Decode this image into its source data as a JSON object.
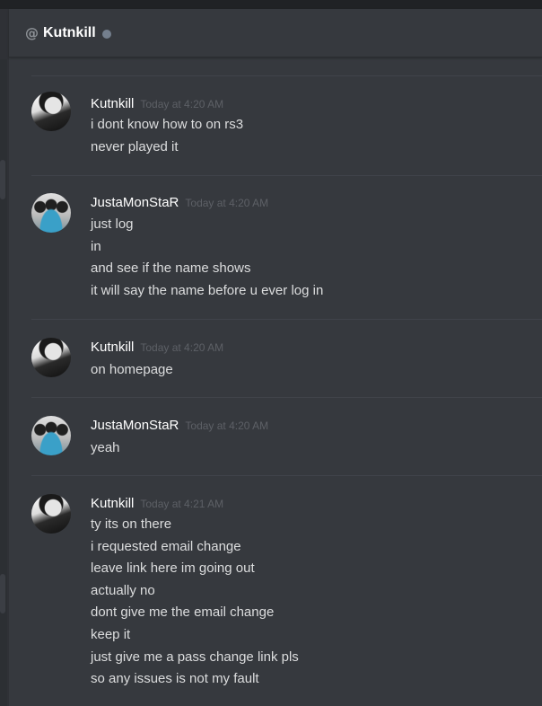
{
  "header": {
    "at_symbol": "@",
    "channel_name": "Kutnkill"
  },
  "messages": [
    {
      "author": "Kutnkill",
      "timestamp": "Today at 4:20 AM",
      "avatar": "kutnkill-avatar",
      "lines": [
        "i dont know how to on rs3",
        "never played it"
      ]
    },
    {
      "author": "JustaMonStaR",
      "timestamp": "Today at 4:20 AM",
      "avatar": "justamonstar-avatar",
      "lines": [
        "just log",
        "in",
        "and see if the name shows",
        "it will say the name before u ever log in"
      ]
    },
    {
      "author": "Kutnkill",
      "timestamp": "Today at 4:20 AM",
      "avatar": "kutnkill-avatar",
      "lines": [
        "on homepage"
      ]
    },
    {
      "author": "JustaMonStaR",
      "timestamp": "Today at 4:20 AM",
      "avatar": "justamonstar-avatar",
      "lines": [
        "yeah"
      ]
    },
    {
      "author": "Kutnkill",
      "timestamp": "Today at 4:21 AM",
      "avatar": "kutnkill-avatar",
      "lines": [
        "ty its on there",
        "i requested email change",
        "leave link here im going out",
        "actually no",
        "dont give me the email change",
        "keep it",
        "just give me a pass change link pls",
        "so any issues is not my fault"
      ]
    }
  ],
  "colors": {
    "background": "#36393e",
    "username": "#ffffff",
    "message_text": "#dcddde",
    "timestamp": "#5d6066",
    "status_offline": "#747f8d"
  }
}
